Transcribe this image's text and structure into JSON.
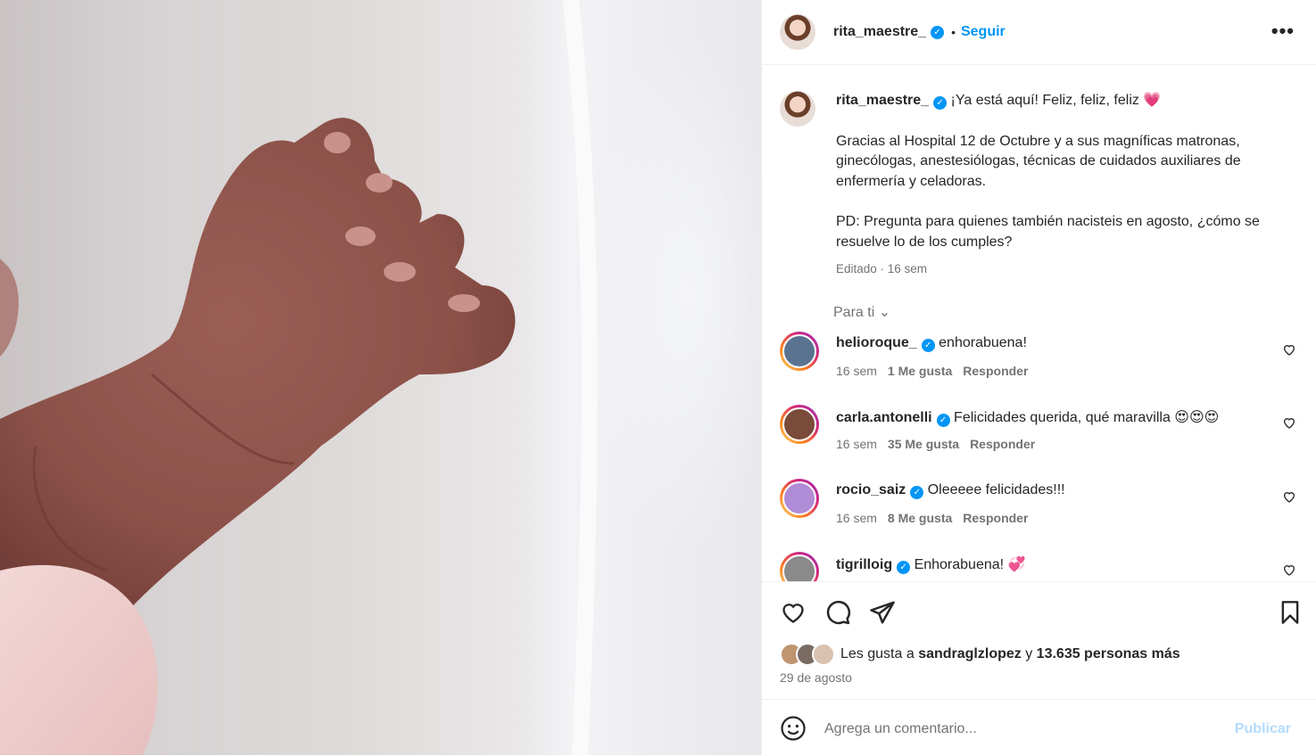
{
  "post": {
    "author": "rita_maestre_",
    "follow_label": "Seguir",
    "separator": "•",
    "more_label": "•••",
    "caption_line1": "¡Ya está aquí! Feliz, feliz, feliz",
    "caption_para2": "Gracias al Hospital 12 de Octubre y a sus magníficas matronas, ginecólogas, anestesiólogas, técnicas de cuidados auxiliares de enfermería y celadoras.",
    "caption_para3": "PD: Pregunta para quienes también nacisteis en agosto, ¿cómo se resuelve lo de los cumples?",
    "caption_meta": "Editado · 16 sem",
    "heart_emoji": "💗"
  },
  "for_you": "Para ti",
  "comments": [
    {
      "user": "helioroque_",
      "text": "enhorabuena!",
      "time": "16 sem",
      "likes": "1 Me gusta",
      "reply": "Responder",
      "ring": "#c13584"
    },
    {
      "user": "carla.antonelli",
      "text": "Felicidades querida, qué maravilla 😍😍😍",
      "time": "16 sem",
      "likes": "35 Me gusta",
      "reply": "Responder",
      "ring": "#c13584"
    },
    {
      "user": "rocio_saiz",
      "text": "Oleeeee felicidades!!!",
      "time": "16 sem",
      "likes": "8 Me gusta",
      "reply": "Responder",
      "ring": "#c13584"
    },
    {
      "user": "tigrilloig",
      "text": "Enhorabuena! 💞",
      "time": "",
      "likes": "",
      "reply": "",
      "ring": "#c13584"
    }
  ],
  "likes_prefix": "Les gusta a",
  "likes_user": "sandraglzlopez",
  "likes_join": "y",
  "likes_rest": "13.635 personas más",
  "post_date": "29 de agosto",
  "add_comment_placeholder": "Agrega un comentario...",
  "publish_label": "Publicar",
  "colors": {
    "accent": "#0095f6",
    "verified": "#0095f6",
    "muted": "#737373"
  }
}
